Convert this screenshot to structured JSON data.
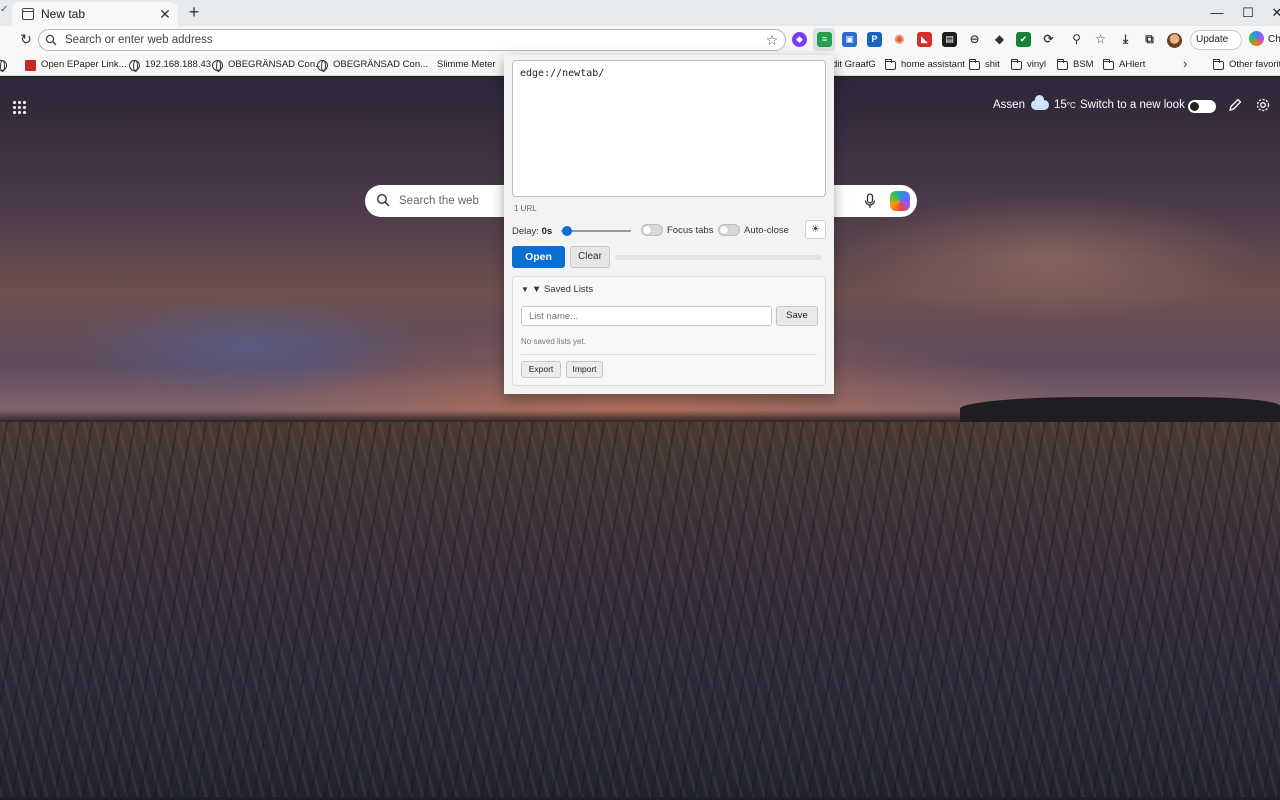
{
  "tab": {
    "title": "New tab"
  },
  "window": {
    "minimize": "—",
    "maximize": "☐",
    "close": "✕"
  },
  "omnibox": {
    "placeholder": "Search or enter web address"
  },
  "toolbar": {
    "update_label": "Update",
    "update_more": "···",
    "copilot_label": "Ch"
  },
  "bookmarks": [
    {
      "label": "Open EPaper Link...",
      "icon": "pdf-icon"
    },
    {
      "label": "192.168.188.43",
      "icon": "globe-icon"
    },
    {
      "label": "OBEGRÄNSAD Con...",
      "icon": "globe-icon"
    },
    {
      "label": "OBEGRÄNSAD Con...",
      "icon": "globe-icon"
    },
    {
      "label": "Slimme Meter",
      "icon": "none"
    },
    {
      "label": "dit GraafG",
      "icon": "none"
    },
    {
      "label": "home assistant",
      "icon": "folder-icon"
    },
    {
      "label": "shit",
      "icon": "folder-icon"
    },
    {
      "label": "vinyl",
      "icon": "folder-icon"
    },
    {
      "label": "BSM",
      "icon": "folder-icon"
    },
    {
      "label": "AHlert",
      "icon": "folder-icon"
    },
    {
      "label": "Other favorite",
      "icon": "folder-icon"
    }
  ],
  "ntp": {
    "weather_city": "Assen",
    "temperature": "15",
    "temperature_unit": "°C",
    "switch_label": "Switch to a new look",
    "search_placeholder": "Search the web"
  },
  "popup": {
    "textarea_value": "edge://newtab/",
    "url_count": "1 URL",
    "delay_label": "Delay:",
    "delay_value": "0s",
    "delay_seconds": 0,
    "focus_tabs_label": "Focus tabs",
    "auto_close_label": "Auto-close",
    "theme_icon": "☀",
    "open_label": "Open",
    "clear_label": "Clear",
    "progress": 0,
    "saved_lists_title": "▼ Saved Lists",
    "list_name_placeholder": "List name...",
    "save_label": "Save",
    "no_saved": "No saved lists yet.",
    "export_label": "Export",
    "import_label": "Import"
  },
  "colors": {
    "accent": "#0a6fd1",
    "chrome": "#f7f7f7"
  }
}
